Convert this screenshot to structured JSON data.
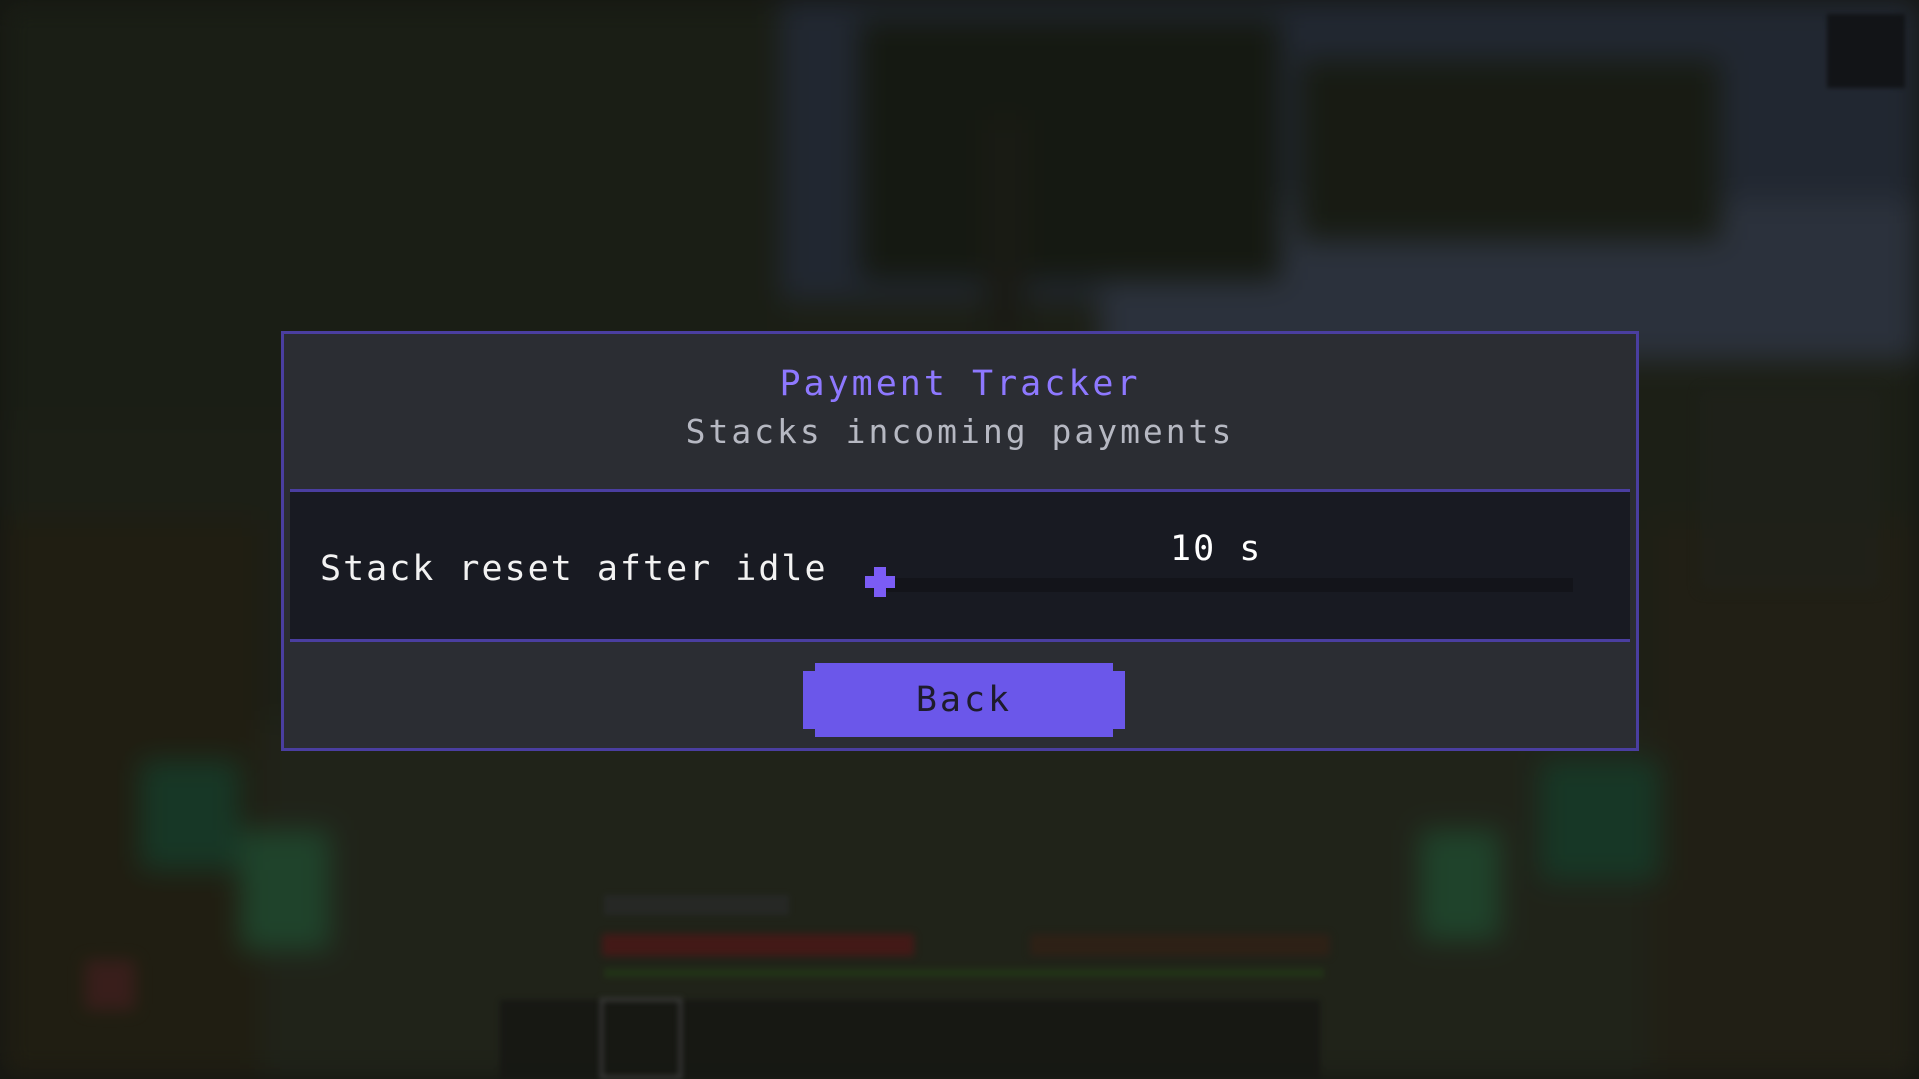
{
  "dialog": {
    "title": "Payment Tracker",
    "subtitle": "Stacks incoming payments"
  },
  "setting": {
    "label": "Stack reset after idle",
    "value_text": "10 s",
    "slider_fraction": 0.0
  },
  "buttons": {
    "back_label": "Back"
  },
  "colors": {
    "accent": "#6b57ea",
    "title": "#8e78ff",
    "panel": "#2b2d33",
    "row": "#181a22",
    "border": "#4a3ea0"
  },
  "icons": {
    "slider_knob": "plus-shaped-knob"
  }
}
